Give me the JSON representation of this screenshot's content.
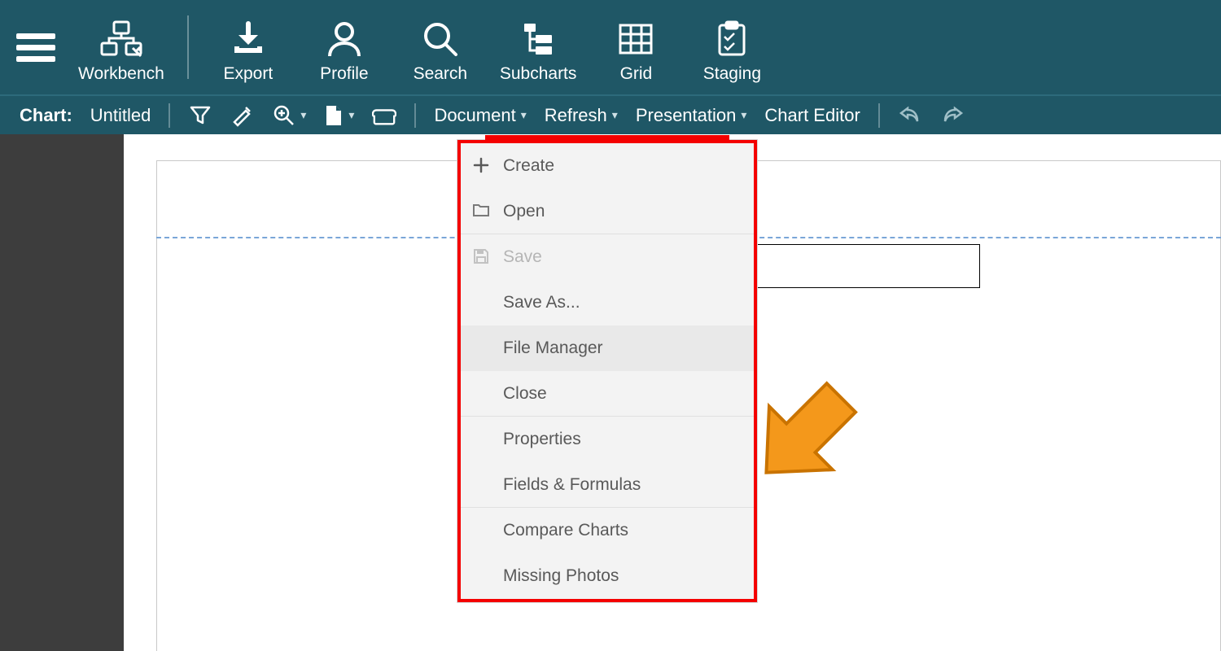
{
  "ribbon": {
    "items": [
      {
        "label": "Workbench"
      },
      {
        "label": "Export"
      },
      {
        "label": "Profile"
      },
      {
        "label": "Search"
      },
      {
        "label": "Subcharts"
      },
      {
        "label": "Grid"
      },
      {
        "label": "Staging"
      }
    ]
  },
  "toolbar": {
    "chart_label": "Chart:",
    "chart_name": "Untitled",
    "document": "Document",
    "refresh": "Refresh",
    "presentation": "Presentation",
    "chart_editor": "Chart Editor"
  },
  "menu": {
    "items": [
      {
        "label": "Create",
        "icon": "plus",
        "sep": false
      },
      {
        "label": "Open",
        "icon": "folder",
        "sep": true
      },
      {
        "label": "Save",
        "icon": "save",
        "disabled": true,
        "sep": false
      },
      {
        "label": "Save As...",
        "sep": false
      },
      {
        "label": "File Manager",
        "hovered": true,
        "sep": false
      },
      {
        "label": "Close",
        "sep": true
      },
      {
        "label": "Properties",
        "sep": false
      },
      {
        "label": "Fields & Formulas",
        "sep": true
      },
      {
        "label": "Compare Charts",
        "sep": false
      },
      {
        "label": "Missing Photos",
        "sep": false
      }
    ]
  }
}
